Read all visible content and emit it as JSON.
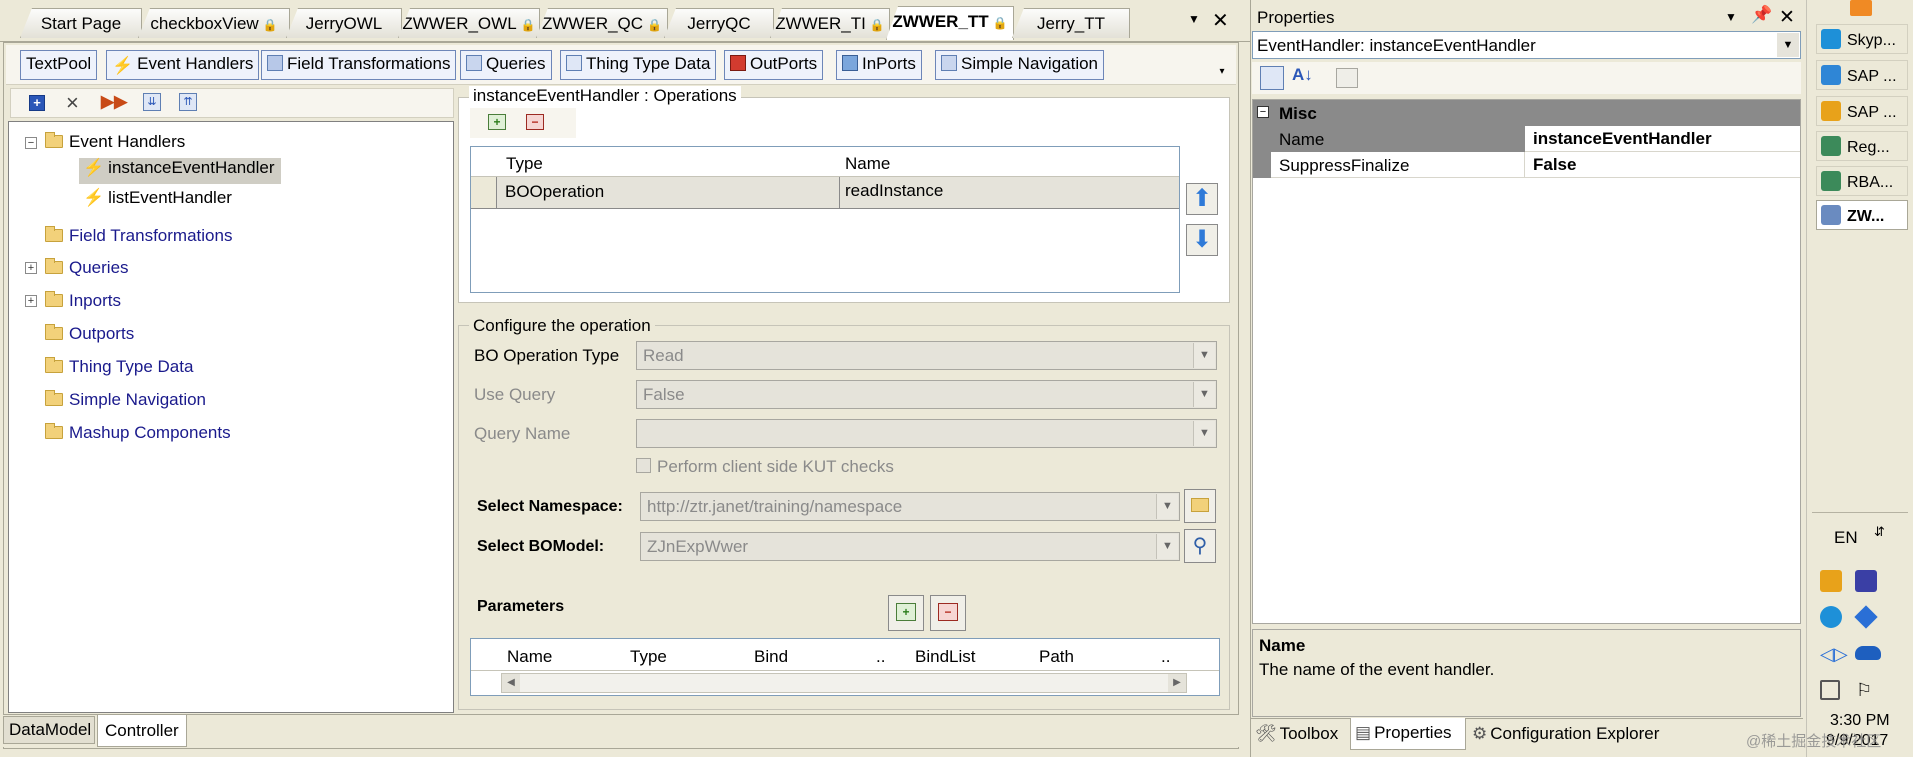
{
  "doc_tabs": [
    {
      "label": "Start Page",
      "locked": false,
      "active": false
    },
    {
      "label": "checkboxView",
      "locked": true,
      "active": false
    },
    {
      "label": "JerryOWL",
      "locked": false,
      "active": false
    },
    {
      "label": "ZWWER_OWL",
      "locked": true,
      "active": false
    },
    {
      "label": "ZWWER_QC",
      "locked": true,
      "active": false
    },
    {
      "label": "JerryQC",
      "locked": false,
      "active": false
    },
    {
      "label": "ZWWER_TI",
      "locked": true,
      "active": false
    },
    {
      "label": "ZWWER_TT",
      "locked": true,
      "active": true
    },
    {
      "label": "Jerry_TT",
      "locked": false,
      "active": false
    }
  ],
  "lock_glyph": "🔒",
  "close_glyph": "✕",
  "menu_glyph": "▼",
  "toolbar": [
    {
      "label": "TextPool",
      "icon": "none"
    },
    {
      "label": "Event Handlers",
      "icon": "bolt-icon"
    },
    {
      "label": "Field Transformations",
      "icon": "transform-icon"
    },
    {
      "label": "Queries",
      "icon": "query-icon"
    },
    {
      "label": "Thing Type Data",
      "icon": "data-icon"
    },
    {
      "label": "OutPorts",
      "icon": "outport-icon"
    },
    {
      "label": "InPorts",
      "icon": "inport-icon"
    },
    {
      "label": "Simple Navigation",
      "icon": "navigation-icon"
    }
  ],
  "tree": {
    "root": {
      "label": "Event Handlers",
      "expander": "−"
    },
    "handlers": [
      {
        "label": "instanceEventHandler",
        "selected": true
      },
      {
        "label": "listEventHandler",
        "selected": false
      }
    ],
    "folders": [
      {
        "label": "Field Transformations",
        "expander": ""
      },
      {
        "label": "Queries",
        "expander": "+"
      },
      {
        "label": "Inports",
        "expander": "+"
      },
      {
        "label": "Outports",
        "expander": ""
      },
      {
        "label": "Thing Type Data",
        "expander": ""
      },
      {
        "label": "Simple Navigation",
        "expander": ""
      },
      {
        "label": "Mashup Components",
        "expander": ""
      }
    ]
  },
  "operations": {
    "title": "instanceEventHandler : Operations",
    "columns": [
      "Type",
      "Name"
    ],
    "rows": [
      {
        "type": "BOOperation",
        "name": "readInstance"
      }
    ]
  },
  "configure": {
    "title": "Configure the operation",
    "bo_operation_type_label": "BO Operation Type",
    "bo_operation_type_value": "Read",
    "use_query_label": "Use Query",
    "use_query_value": "False",
    "query_name_label": "Query Name",
    "query_name_value": "",
    "kut_checkbox_label": "Perform client side KUT checks",
    "kut_checked": false,
    "namespace_label": "Select Namespace:",
    "namespace_value": "http://ztr.janet/training/namespace",
    "bomodel_label": "Select BOModel:",
    "bomodel_value": "ZJnExpWwer"
  },
  "parameters": {
    "title": "Parameters",
    "columns": [
      "Name",
      "Type",
      "Bind",
      "..",
      "BindList",
      "Path",
      ".."
    ]
  },
  "bottom_tabs": [
    {
      "label": "DataModel",
      "active": false
    },
    {
      "label": "Controller",
      "active": true
    }
  ],
  "properties": {
    "title": "Properties",
    "selector_value": "EventHandler: instanceEventHandler",
    "category": "Misc",
    "rows": [
      {
        "name": "Name",
        "value": "instanceEventHandler",
        "selected": true
      },
      {
        "name": "SuppressFinalize",
        "value": "False",
        "selected": false
      }
    ],
    "desc_title": "Name",
    "desc_text": "The name of the event handler."
  },
  "panel_tabs": [
    {
      "label": "Toolbox",
      "active": false
    },
    {
      "label": "Properties",
      "active": true
    },
    {
      "label": "Configuration Explorer",
      "active": false
    }
  ],
  "taskbar": {
    "buttons": [
      {
        "label": "Skyp...",
        "icon": "skype-icon",
        "color": "#1e90d8"
      },
      {
        "label": "SAP ...",
        "icon": "ie-icon",
        "color": "#2f86d6"
      },
      {
        "label": "SAP ...",
        "icon": "sap-logon-icon",
        "color": "#e8a21a"
      },
      {
        "label": "Reg...",
        "icon": "registry-icon",
        "color": "#3c8a5a"
      },
      {
        "label": "RBA...",
        "icon": "registry-icon",
        "color": "#3c8a5a"
      },
      {
        "label": "ZW...",
        "icon": "vs-icon",
        "color": "#6a8bc0"
      }
    ],
    "lang": "EN",
    "time": "3:30 PM",
    "date": "9/9/2017"
  },
  "watermark": "@稀土掘金技术社区",
  "colors": {
    "accent": "#316ac5",
    "selection": "#cfcdc4",
    "tree_link": "#1a1a8c",
    "disabled": "#8a8a8a"
  }
}
